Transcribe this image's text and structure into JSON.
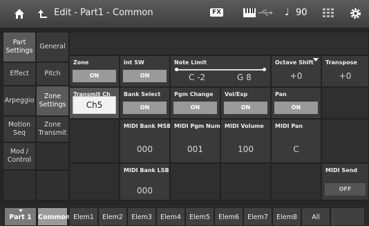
{
  "topbar": {
    "title": "Edit - Part1 - Common",
    "fx": "FX",
    "note_symbol": "♩",
    "tempo": "90"
  },
  "nav_left": [
    {
      "label": "Part Settings",
      "selected": true
    },
    {
      "label": "Effect",
      "selected": false
    },
    {
      "label": "Arpeggio",
      "selected": false
    },
    {
      "label": "Motion Seq",
      "selected": false
    },
    {
      "label": "Mod / Control",
      "selected": false
    }
  ],
  "nav_right": [
    {
      "label": "General",
      "selected": false
    },
    {
      "label": "Pitch",
      "selected": false
    },
    {
      "label": "Zone Settings",
      "selected": true
    },
    {
      "label": "Zone Transmit",
      "selected": false
    }
  ],
  "params": {
    "zone": {
      "label": "Zone",
      "value": "ON"
    },
    "int_sw": {
      "label": "Int SW",
      "value": "ON"
    },
    "note_limit": {
      "label": "Note Limit",
      "low": "C -2",
      "high": "G 8"
    },
    "octave_shift": {
      "label": "Octave Shift",
      "value": "+0"
    },
    "transpose": {
      "label": "Transpose",
      "value": "+0"
    },
    "transmit_ch": {
      "label": "Transmit Ch",
      "value": "Ch5"
    },
    "bank_select": {
      "label": "Bank Select",
      "value": "ON"
    },
    "pgm_change": {
      "label": "Pgm Change",
      "value": "ON"
    },
    "vol_exp": {
      "label": "Vol/Exp",
      "value": "ON"
    },
    "pan": {
      "label": "Pan",
      "value": "ON"
    },
    "midi_bank_msb": {
      "label": "MIDI Bank MSB",
      "value": "000"
    },
    "midi_pgm_num": {
      "label": "MIDI Pgm Num",
      "value": "001"
    },
    "midi_volume": {
      "label": "MIDI Volume",
      "value": "100"
    },
    "midi_pan": {
      "label": "MIDI Pan",
      "value": "C"
    },
    "midi_bank_lsb": {
      "label": "MIDI Bank LSB",
      "value": "000"
    },
    "midi_send": {
      "label": "MIDI Send",
      "value": "OFF"
    }
  },
  "bottom": {
    "part": "Part 1",
    "common": "Common",
    "elements": [
      "Elem1",
      "Elem2",
      "Elem3",
      "Elem4",
      "Elem5",
      "Elem6",
      "Elem7",
      "Elem8",
      "All"
    ]
  },
  "colors": {
    "button_on": "#9a9a9a",
    "button_off": "#555555",
    "selected_value_bg": "#f2f2f2"
  }
}
